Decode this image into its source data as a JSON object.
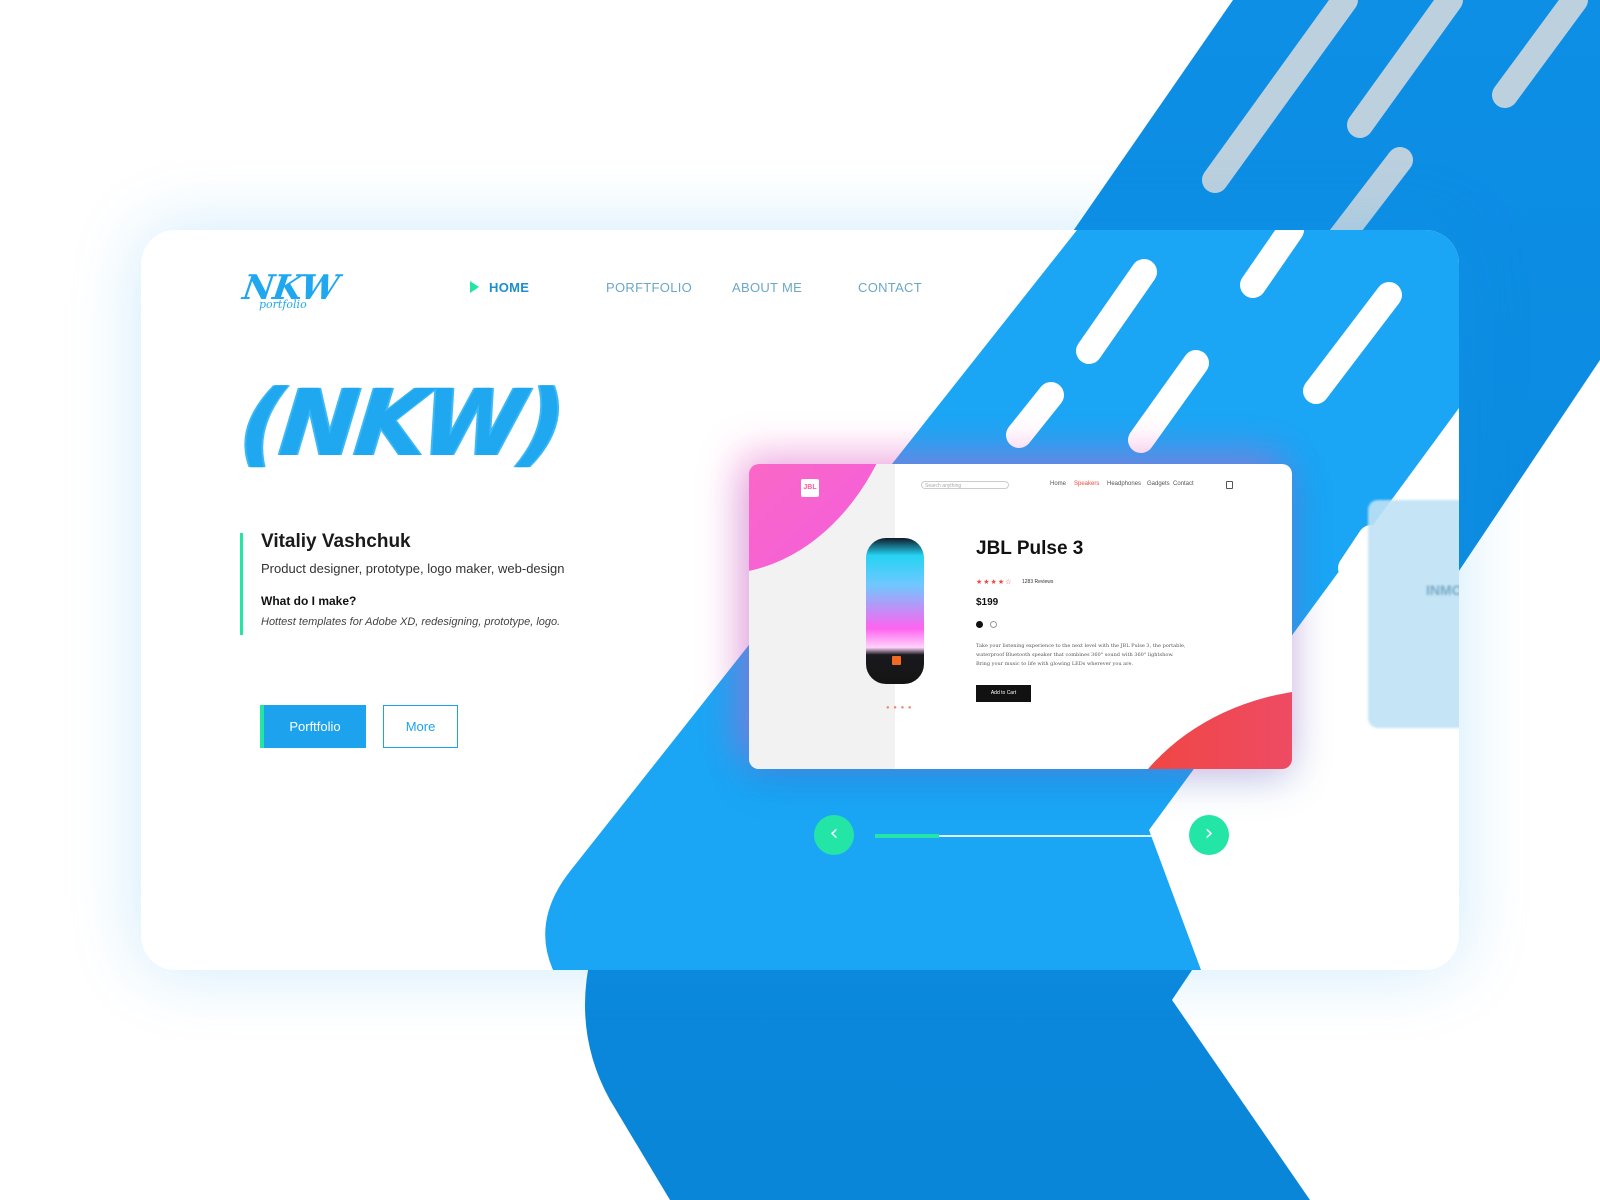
{
  "brand": {
    "logo": "NKW",
    "logo_sub": "portfolio",
    "hero_logo": "(NKW)"
  },
  "nav": {
    "items": [
      {
        "label": "HOME",
        "active": true
      },
      {
        "label": "PORFTFOLIO",
        "active": false
      },
      {
        "label": "ABOUT ME",
        "active": false
      },
      {
        "label": "CONTACT",
        "active": false
      }
    ]
  },
  "intro": {
    "name": "Vitaliy Vashchuk",
    "role": "Product designer, prototype, logo maker, web-design",
    "question": "What do I make?",
    "answer": "Hottest templates for Adobe XD, redesigning, prototype, logo."
  },
  "buttons": {
    "primary": "Porftfolio",
    "secondary": "More"
  },
  "preview": {
    "brand": "JBL",
    "search_placeholder": "Search anything",
    "nav": [
      "Home",
      "Speakers",
      "Headphones",
      "Gadgets",
      "Contact"
    ],
    "nav_active": "Speakers",
    "title": "JBL Pulse 3",
    "rating": 4,
    "rating_max": 5,
    "reviews": "1283 Reviews",
    "price": "$199",
    "description": "Take your listening experience to the next level with the JBL Pulse 3, the portable, waterproof Bluetooth speaker that combines 360° sound with 360° lightshow. Bring your music to life with glowing LEDs wherever you are.",
    "add_to_cart": "Add to Cart",
    "colors": [
      "#111111",
      "#ffffff"
    ]
  },
  "ghost_preview": {
    "title": "INMO"
  },
  "slider": {
    "progress": 0.22,
    "prev_icon": "chevron-left-icon",
    "next_icon": "chevron-right-icon"
  },
  "colors": {
    "accent": "#23e5a6",
    "primary": "#1da3ee",
    "ribbon": "#1aa6f5",
    "pink": "#f25ce3",
    "red": "#ef4a3e"
  }
}
